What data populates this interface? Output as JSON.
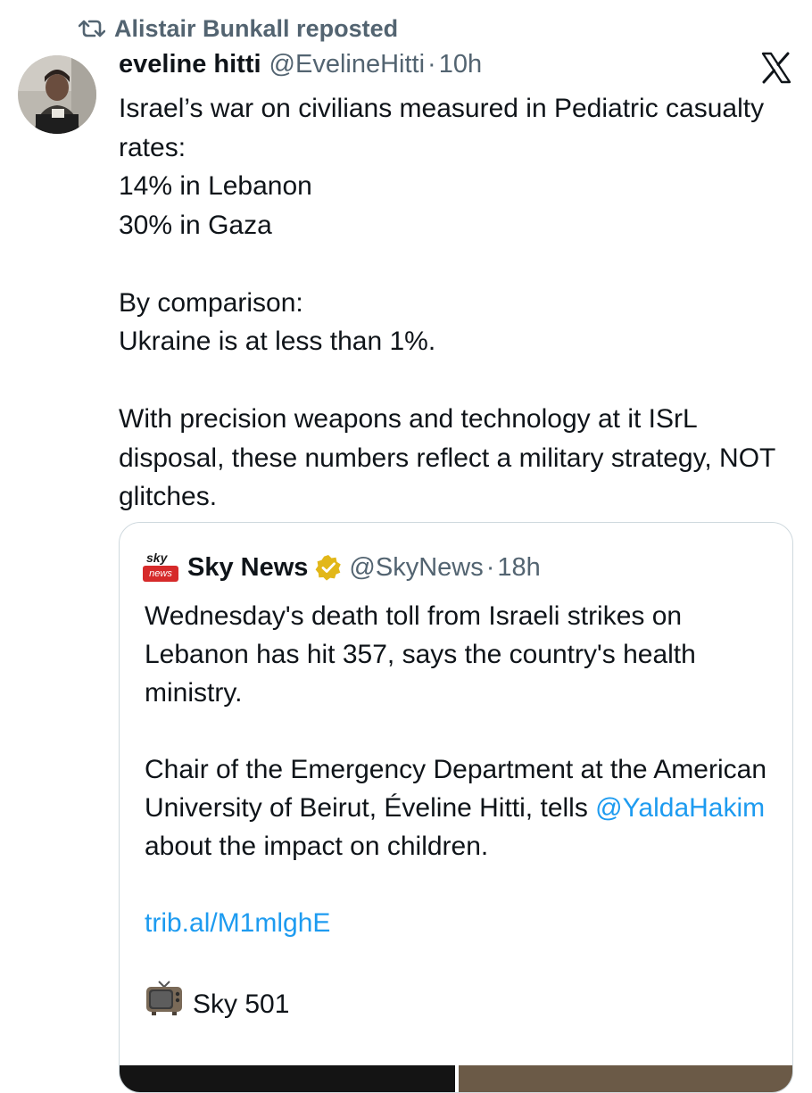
{
  "repost": {
    "text": "Alistair Bunkall reposted",
    "icon": "repost-icon"
  },
  "brand": {
    "icon": "x-logo-icon"
  },
  "tweet": {
    "author_name": "eveline hitti",
    "handle": "@EvelineHitti",
    "dot": "·",
    "time": "10h",
    "paragraphs": [
      "Israel’s war on civilians measured in Pediatric casualty rates:\n14% in Lebanon\n30% in Gaza",
      "By comparison:\nUkraine is at less than 1%.",
      "With precision weapons and technology at it ISrL disposal, these numbers reflect a military strategy, NOT glitches."
    ]
  },
  "quote": {
    "logo_sky": "sky",
    "logo_news": "news",
    "author_name": "Sky News",
    "handle": "@SkyNews",
    "dot": "·",
    "time": "18h",
    "p1": "Wednesday's death toll from Israeli strikes on Lebanon has hit 357, says the country's health ministry.",
    "p2_before": "Chair of the Emergency Department at the American University of Beirut, Éveline Hitti, tells ",
    "p2_mention": "@YaldaHakim",
    "p2_after": " about the impact on children.",
    "link": "trib.al/M1mlghE",
    "tv_label": "Sky 501",
    "tv_icon": "television-icon"
  },
  "colors": {
    "secondary_text": "#536471",
    "link": "#1d9bf0",
    "border": "#cfd9de",
    "verified_gold": "#e2b719",
    "sky_news_red": "#d62a2a"
  }
}
